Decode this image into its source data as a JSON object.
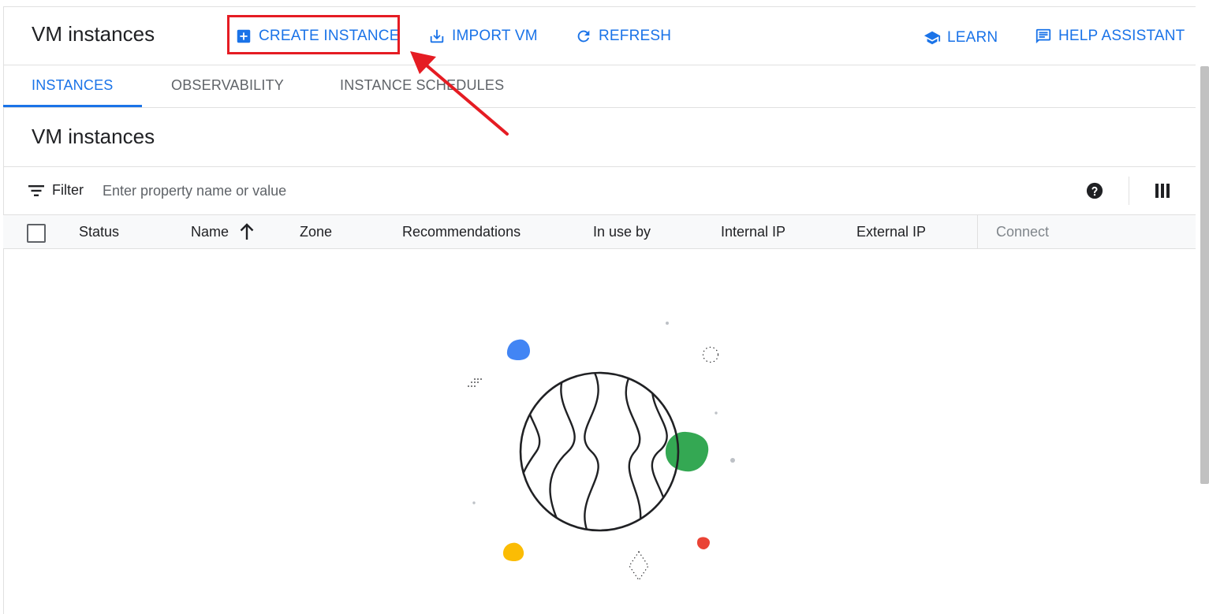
{
  "header": {
    "title": "VM instances",
    "actions": {
      "create_instance": "CREATE INSTANCE",
      "import_vm": "IMPORT VM",
      "refresh": "REFRESH",
      "learn": "LEARN",
      "help_assistant": "HELP ASSISTANT"
    }
  },
  "tabs": [
    {
      "label": "INSTANCES",
      "active": true
    },
    {
      "label": "OBSERVABILITY",
      "active": false
    },
    {
      "label": "INSTANCE SCHEDULES",
      "active": false
    }
  ],
  "section": {
    "title": "VM instances"
  },
  "filter": {
    "label": "Filter",
    "placeholder": "Enter property name or value",
    "value": ""
  },
  "table": {
    "columns": [
      "Status",
      "Name",
      "Zone",
      "Recommendations",
      "In use by",
      "Internal IP",
      "External IP",
      "Connect"
    ],
    "sort_column": "Name",
    "sort_direction": "ascending",
    "rows": []
  },
  "colors": {
    "accent": "#1a73e8",
    "highlight": "#e51c23",
    "blob_blue": "#4285f4",
    "blob_green": "#34a853",
    "blob_yellow": "#fbbc04",
    "blob_red": "#ea4335"
  },
  "icons": {
    "create_instance": "add-box-icon",
    "import_vm": "download-icon",
    "refresh": "refresh-icon",
    "learn": "school-cap-icon",
    "help_assistant": "chat-icon",
    "filter": "filter-icon",
    "help": "help-circle-icon",
    "columns": "column-display-icon",
    "sort": "arrow-up-icon"
  }
}
